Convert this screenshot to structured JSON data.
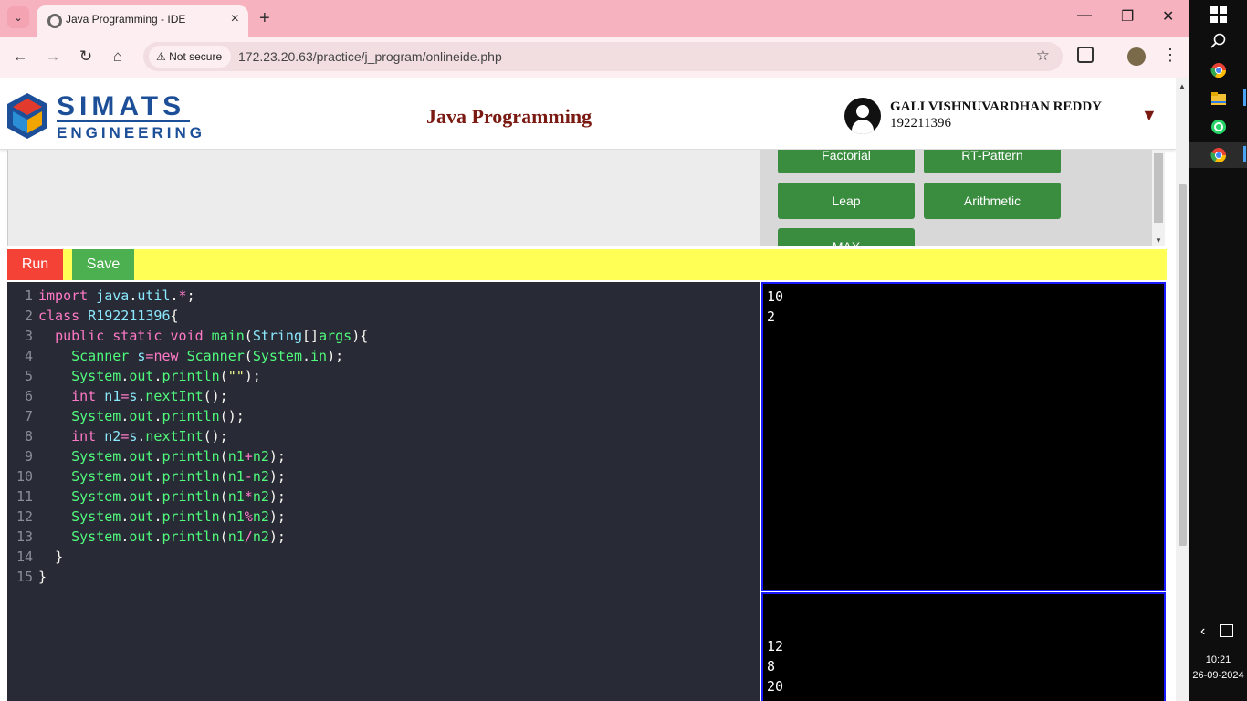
{
  "browser": {
    "tab_title": "Java Programming - IDE",
    "not_secure_label": "Not secure",
    "url": "172.23.20.63/practice/j_program/onlineide.php"
  },
  "header": {
    "logo_line1": "SIMATS",
    "logo_line2": "ENGINEERING",
    "app_title": "Java Programming",
    "user_name": "GALI VISHNUVARDHAN REDDY",
    "user_id": "192211396"
  },
  "programs": [
    "Factorial",
    "RT-Pattern",
    "Leap",
    "Arithmetic",
    "MAX"
  ],
  "actions": {
    "run": "Run",
    "save": "Save"
  },
  "editor": {
    "lines": [
      {
        "n": "1",
        "indent": "",
        "tokens": [
          [
            "kw",
            "import"
          ],
          [
            "",
            " "
          ],
          [
            "ty",
            "java"
          ],
          [
            "",
            "."
          ],
          [
            "ty",
            "util"
          ],
          [
            "",
            "."
          ],
          [
            "op",
            "*"
          ],
          [
            "",
            ";"
          ]
        ]
      },
      {
        "n": "2",
        "indent": "",
        "tokens": [
          [
            "kw",
            "class"
          ],
          [
            "",
            " "
          ],
          [
            "ty",
            "R192211396"
          ],
          [
            "",
            "{"
          ]
        ]
      },
      {
        "n": "3",
        "indent": "  ",
        "tokens": [
          [
            "kw",
            "public"
          ],
          [
            "",
            " "
          ],
          [
            "kw",
            "static"
          ],
          [
            "",
            " "
          ],
          [
            "kw",
            "void"
          ],
          [
            "",
            " "
          ],
          [
            "fn",
            "main"
          ],
          [
            "",
            "("
          ],
          [
            "ty",
            "String"
          ],
          [
            "",
            "[]"
          ],
          [
            "fn",
            "args"
          ],
          [
            "",
            "){"
          ]
        ]
      },
      {
        "n": "4",
        "indent": "    ",
        "tokens": [
          [
            "fn",
            "Scanner"
          ],
          [
            "",
            " "
          ],
          [
            "ty",
            "s"
          ],
          [
            "op",
            "="
          ],
          [
            "kw",
            "new"
          ],
          [
            "",
            " "
          ],
          [
            "fn",
            "Scanner"
          ],
          [
            "",
            "("
          ],
          [
            "fn",
            "System"
          ],
          [
            "",
            "."
          ],
          [
            "fn",
            "in"
          ],
          [
            "",
            ");"
          ]
        ]
      },
      {
        "n": "5",
        "indent": "    ",
        "tokens": [
          [
            "fn",
            "System"
          ],
          [
            "",
            "."
          ],
          [
            "fn",
            "out"
          ],
          [
            "",
            "."
          ],
          [
            "fn",
            "println"
          ],
          [
            "",
            "("
          ],
          [
            "str",
            "\"\""
          ],
          [
            "",
            ");"
          ]
        ]
      },
      {
        "n": "6",
        "indent": "    ",
        "tokens": [
          [
            "kw",
            "int"
          ],
          [
            "",
            " "
          ],
          [
            "ty",
            "n1"
          ],
          [
            "op",
            "="
          ],
          [
            "ty",
            "s"
          ],
          [
            "",
            "."
          ],
          [
            "fn",
            "nextInt"
          ],
          [
            "",
            "();"
          ]
        ]
      },
      {
        "n": "7",
        "indent": "    ",
        "tokens": [
          [
            "fn",
            "System"
          ],
          [
            "",
            "."
          ],
          [
            "fn",
            "out"
          ],
          [
            "",
            "."
          ],
          [
            "fn",
            "println"
          ],
          [
            "",
            "();"
          ]
        ]
      },
      {
        "n": "8",
        "indent": "    ",
        "tokens": [
          [
            "kw",
            "int"
          ],
          [
            "",
            " "
          ],
          [
            "ty",
            "n2"
          ],
          [
            "op",
            "="
          ],
          [
            "ty",
            "s"
          ],
          [
            "",
            "."
          ],
          [
            "fn",
            "nextInt"
          ],
          [
            "",
            "();"
          ]
        ]
      },
      {
        "n": "9",
        "indent": "    ",
        "tokens": [
          [
            "fn",
            "System"
          ],
          [
            "",
            "."
          ],
          [
            "fn",
            "out"
          ],
          [
            "",
            "."
          ],
          [
            "fn",
            "println"
          ],
          [
            "",
            "("
          ],
          [
            "fn",
            "n1"
          ],
          [
            "op",
            "+"
          ],
          [
            "fn",
            "n2"
          ],
          [
            "",
            ");"
          ]
        ]
      },
      {
        "n": "10",
        "indent": "    ",
        "tokens": [
          [
            "fn",
            "System"
          ],
          [
            "",
            "."
          ],
          [
            "fn",
            "out"
          ],
          [
            "",
            "."
          ],
          [
            "fn",
            "println"
          ],
          [
            "",
            "("
          ],
          [
            "fn",
            "n1"
          ],
          [
            "op",
            "-"
          ],
          [
            "fn",
            "n2"
          ],
          [
            "",
            ");"
          ]
        ]
      },
      {
        "n": "11",
        "indent": "    ",
        "tokens": [
          [
            "fn",
            "System"
          ],
          [
            "",
            "."
          ],
          [
            "fn",
            "out"
          ],
          [
            "",
            "."
          ],
          [
            "fn",
            "println"
          ],
          [
            "",
            "("
          ],
          [
            "fn",
            "n1"
          ],
          [
            "op",
            "*"
          ],
          [
            "fn",
            "n2"
          ],
          [
            "",
            ");"
          ]
        ]
      },
      {
        "n": "12",
        "indent": "    ",
        "tokens": [
          [
            "fn",
            "System"
          ],
          [
            "",
            "."
          ],
          [
            "fn",
            "out"
          ],
          [
            "",
            "."
          ],
          [
            "fn",
            "println"
          ],
          [
            "",
            "("
          ],
          [
            "fn",
            "n1"
          ],
          [
            "op",
            "%"
          ],
          [
            "fn",
            "n2"
          ],
          [
            "",
            ");"
          ]
        ]
      },
      {
        "n": "13",
        "indent": "    ",
        "tokens": [
          [
            "fn",
            "System"
          ],
          [
            "",
            "."
          ],
          [
            "fn",
            "out"
          ],
          [
            "",
            "."
          ],
          [
            "fn",
            "println"
          ],
          [
            "",
            "("
          ],
          [
            "fn",
            "n1"
          ],
          [
            "op",
            "/"
          ],
          [
            "fn",
            "n2"
          ],
          [
            "",
            ");"
          ]
        ]
      },
      {
        "n": "14",
        "indent": "  ",
        "tokens": [
          [
            "",
            "}"
          ]
        ]
      },
      {
        "n": "15",
        "indent": "",
        "tokens": [
          [
            "",
            "}"
          ]
        ]
      }
    ]
  },
  "input_lines": [
    "10",
    "2"
  ],
  "output_lines": [
    "12",
    "8",
    "20"
  ],
  "clock": {
    "time": "10:21",
    "date": "26-09-2024"
  },
  "colors": {
    "run": "#f44336",
    "save": "#4caf50",
    "program_button": "#3a8c3f",
    "action_bar": "#ffff55",
    "editor_bg": "#282a36",
    "title": "#7a1a12"
  }
}
